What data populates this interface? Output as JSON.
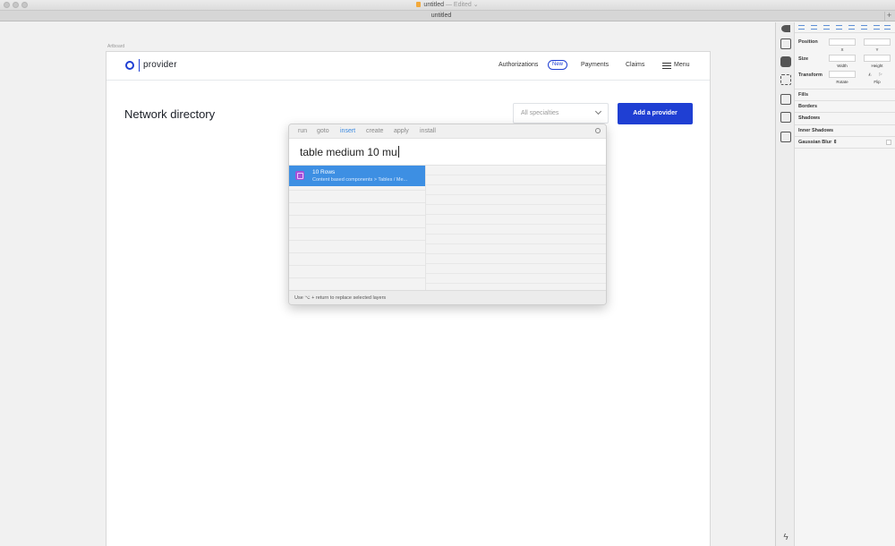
{
  "window": {
    "title": "untitled",
    "title_status": "— Edited ⌄",
    "tab_label": "untitled",
    "new_tab": "+"
  },
  "canvas": {
    "artboard_label": "Artboard"
  },
  "site": {
    "logo_text": "provider",
    "nav": {
      "authorizations": "Authorizations",
      "new_badge": "New",
      "payments": "Payments",
      "claims": "Claims",
      "menu": "Menu"
    },
    "page_title": "Network directory",
    "specialty_select": "All specialties",
    "add_provider_button": "Add a provider"
  },
  "palette": {
    "tabs": [
      "run",
      "goto",
      "insert",
      "create",
      "apply",
      "install"
    ],
    "active_tab": "insert",
    "query": "table medium 10 mu",
    "result": {
      "title": "10 Rows",
      "path": "Content based components > Tables / Me..."
    },
    "footer": "Use ⌥ + return to replace selected layers"
  },
  "inspector": {
    "position_label": "Position",
    "x_caption": "X",
    "y_caption": "Y",
    "size_label": "Size",
    "width_caption": "Width",
    "height_caption": "Height",
    "transform_label": "Transform",
    "rotate_caption": "Rotate",
    "flip_caption": "Flip",
    "sections": [
      "Fills",
      "Borders",
      "Shadows",
      "Inner Shadows",
      "Gaussian Blur ⇕"
    ]
  },
  "colors": {
    "brand": "#1f3fd3",
    "highlight": "#3d8fe3",
    "plugin_icon": "#a64fd8"
  }
}
